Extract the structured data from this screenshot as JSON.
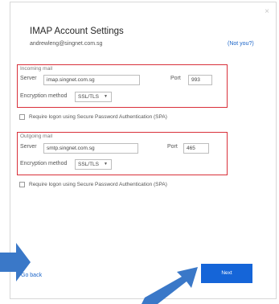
{
  "dialog": {
    "close_glyph": "×",
    "title": "IMAP Account Settings",
    "email": "andrewleng@singnet.com.sg",
    "not_you": "(Not you?)"
  },
  "incoming": {
    "section_label": "Incoming mail",
    "server_label": "Server",
    "server_value": "imap.singnet.com.sg",
    "port_label": "Port",
    "port_value": "993",
    "encryption_label": "Encryption method",
    "encryption_value": "SSL/TLS",
    "spa_label": "Require logon using Secure Password Authentication (SPA)"
  },
  "outgoing": {
    "section_label": "Outgoing mail",
    "server_label": "Server",
    "server_value": "smtp.singnet.com.sg",
    "port_label": "Port",
    "port_value": "465",
    "encryption_label": "Encryption method",
    "encryption_value": "SSL/TLS",
    "spa_label": "Require logon using Secure Password Authentication (SPA)"
  },
  "footer": {
    "go_back": "Go back",
    "next": "Next"
  },
  "colors": {
    "highlight_border": "#d9303a",
    "primary_button": "#1565d8",
    "link": "#1a64c8",
    "arrow": "#3a78c8"
  },
  "icons": [
    "close-icon",
    "chevron-down-icon",
    "arrow-right-icon",
    "arrow-up-right-icon"
  ]
}
